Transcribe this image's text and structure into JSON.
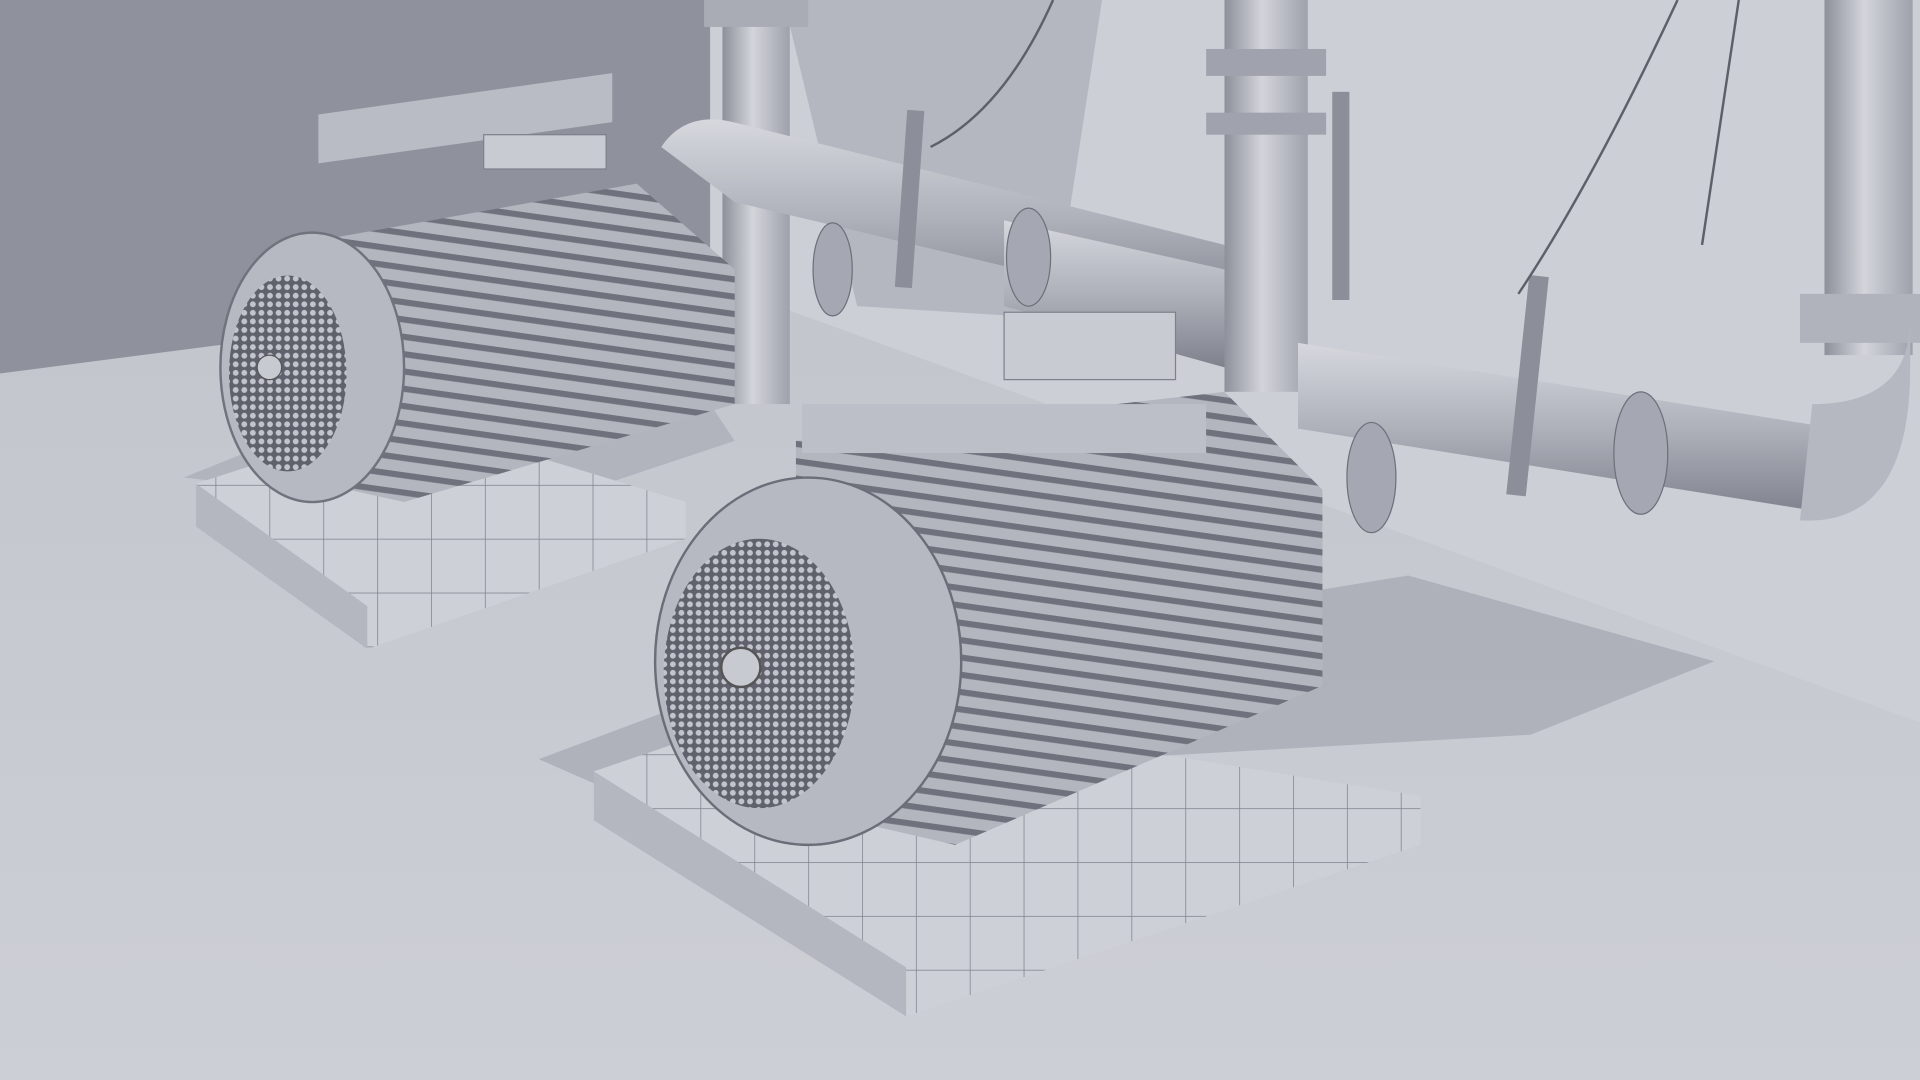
{
  "scene": {
    "subject": "pump-motors",
    "colors": {
      "wall_dark": "#8d909b",
      "wall_light": "#cfd1d8",
      "floor": "#c6c8d0",
      "shadow": "#9a9da8",
      "metal": "#b9bcc5",
      "metal_dark": "#7e818c",
      "wire": "#5d606a"
    }
  }
}
